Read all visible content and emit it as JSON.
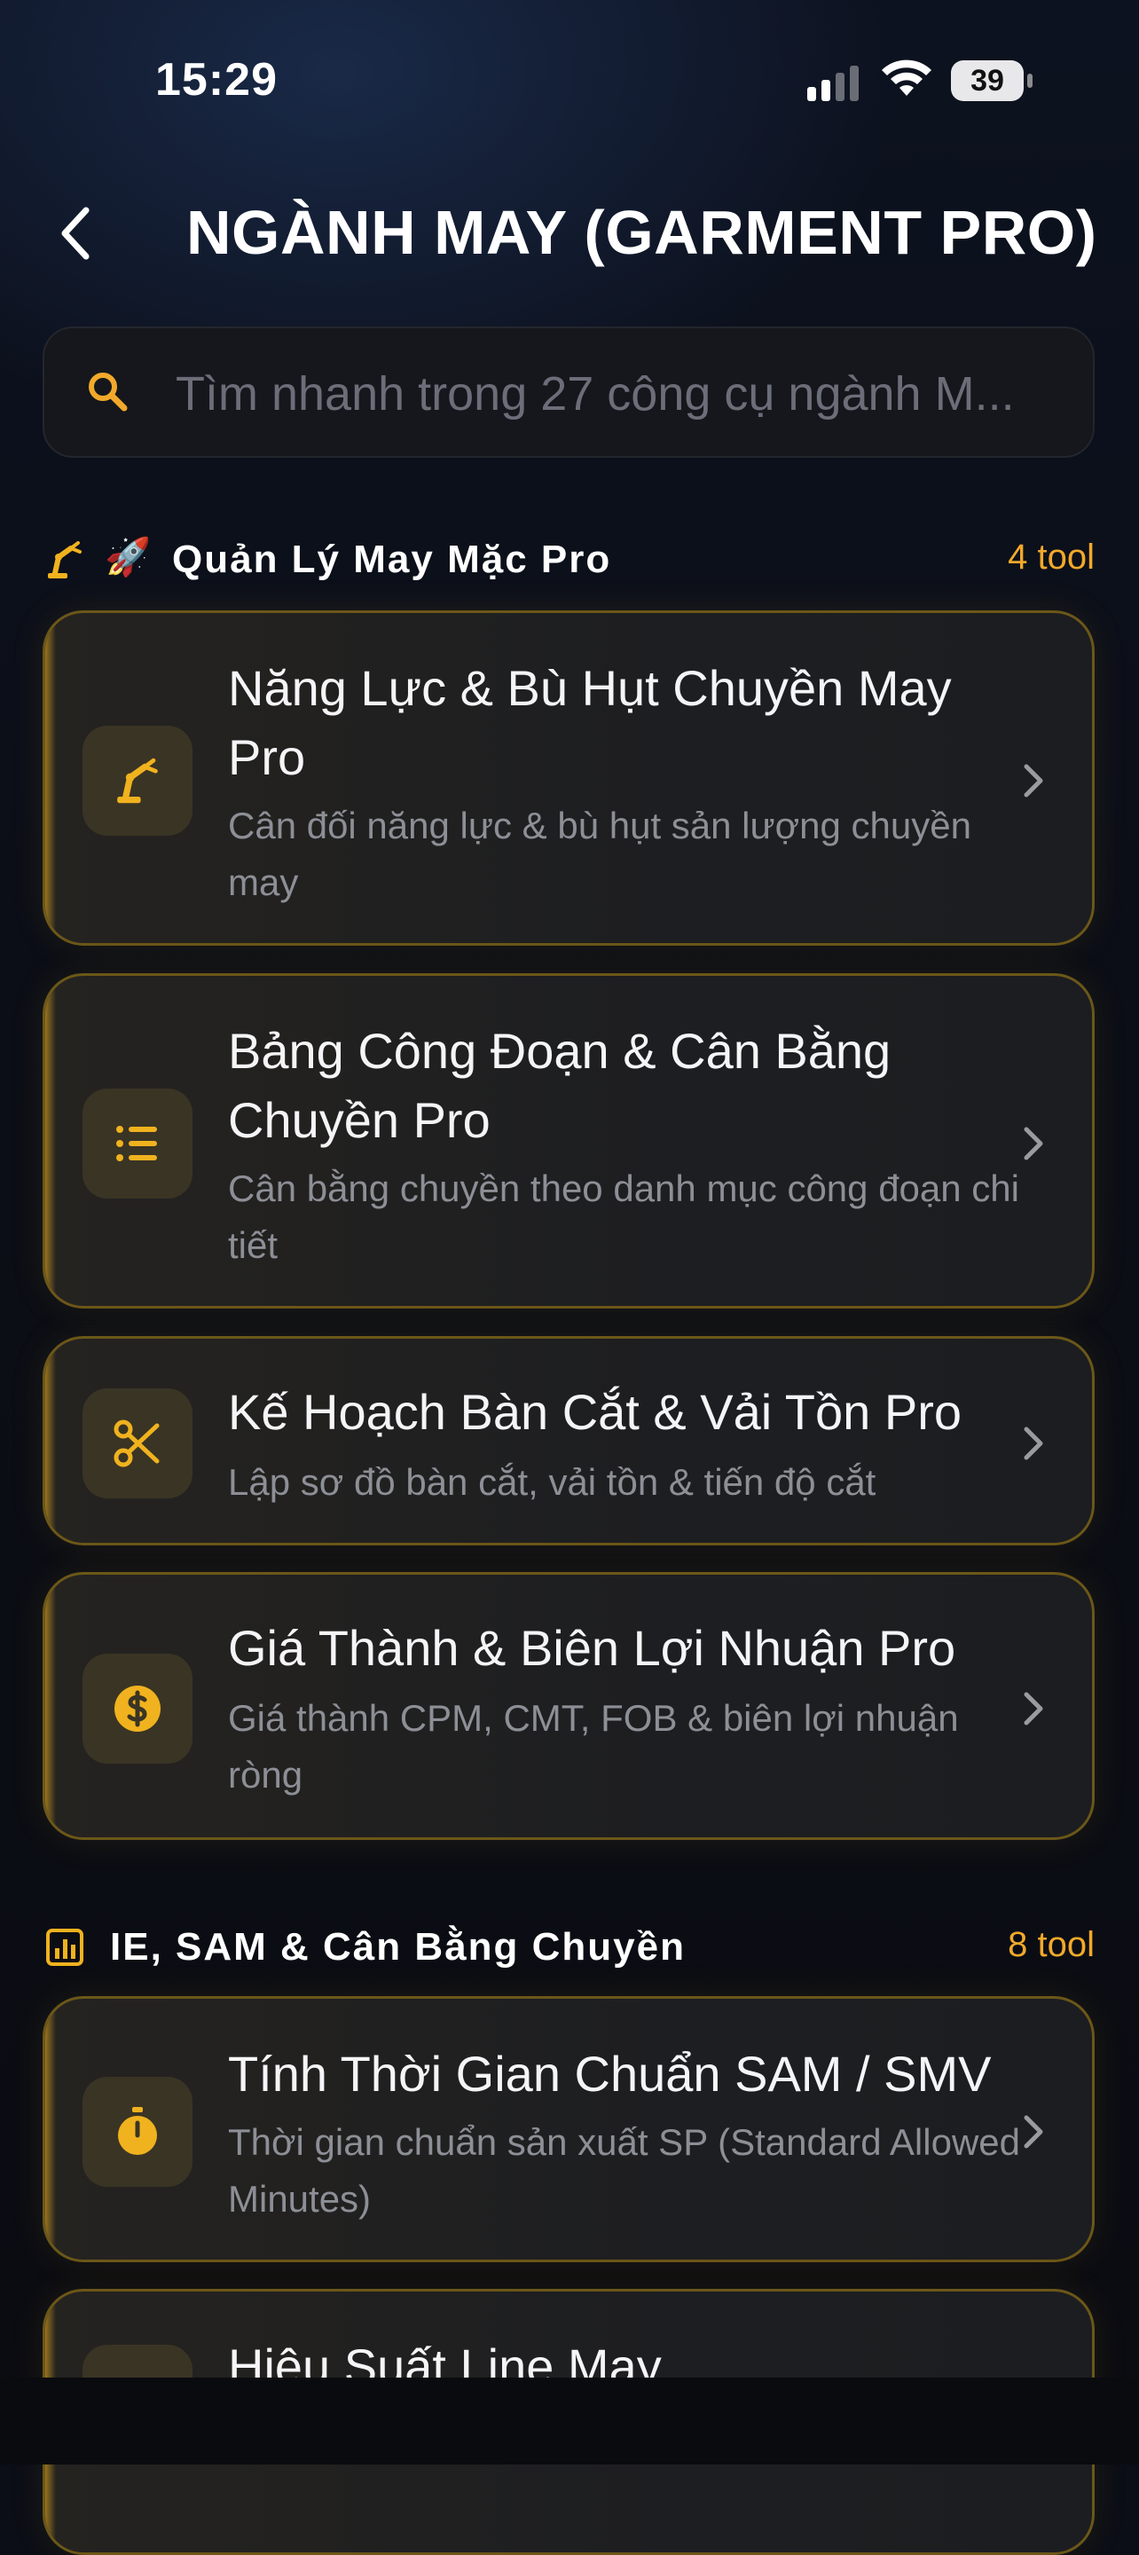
{
  "status_bar": {
    "time": "15:29",
    "battery": "39"
  },
  "header": {
    "title": "NGÀNH MAY (GARMENT PRO)"
  },
  "search": {
    "placeholder": "Tìm nhanh trong 27 công cụ ngành M..."
  },
  "sections": [
    {
      "icon": "robot-arm-icon",
      "emoji": "🚀",
      "title": "Quản Lý May Mặc Pro",
      "count": "4 tool",
      "items": [
        {
          "icon": "robot-arm-icon",
          "title": "Năng Lực & Bù Hụt Chuyền May Pro",
          "subtitle": "Cân đối năng lực & bù hụt sản lượng chuyền may"
        },
        {
          "icon": "list-icon",
          "title": "Bảng Công Đoạn & Cân Bằng Chuyền Pro",
          "subtitle": "Cân bằng chuyền theo danh mục công đoạn chi tiết"
        },
        {
          "icon": "scissors-icon",
          "title": "Kế Hoạch Bàn Cắt & Vải Tồn Pro",
          "subtitle": "Lập sơ đồ bàn cắt, vải tồn & tiến độ cắt"
        },
        {
          "icon": "dollar-icon",
          "title": "Giá Thành & Biên Lợi Nhuận Pro",
          "subtitle": "Giá thành CPM, CMT, FOB & biên lợi nhuận ròng"
        }
      ]
    },
    {
      "icon": "bar-chart-icon",
      "title": "IE, SAM & Cân Bằng Chuyền",
      "count": "8 tool",
      "items": [
        {
          "icon": "stopwatch-icon",
          "title": "Tính Thời Gian Chuẩn SAM / SMV",
          "subtitle": "Thời gian chuẩn sản xuất SP (Standard Allowed Minutes)"
        },
        {
          "icon": "gauge-icon",
          "title": "Hiệu Suất Line May",
          "subtitle": ""
        }
      ]
    }
  ],
  "colors": {
    "accent": "#f2a92b",
    "icon_gold": "#f0b21e",
    "card_border": "#6b5718"
  }
}
